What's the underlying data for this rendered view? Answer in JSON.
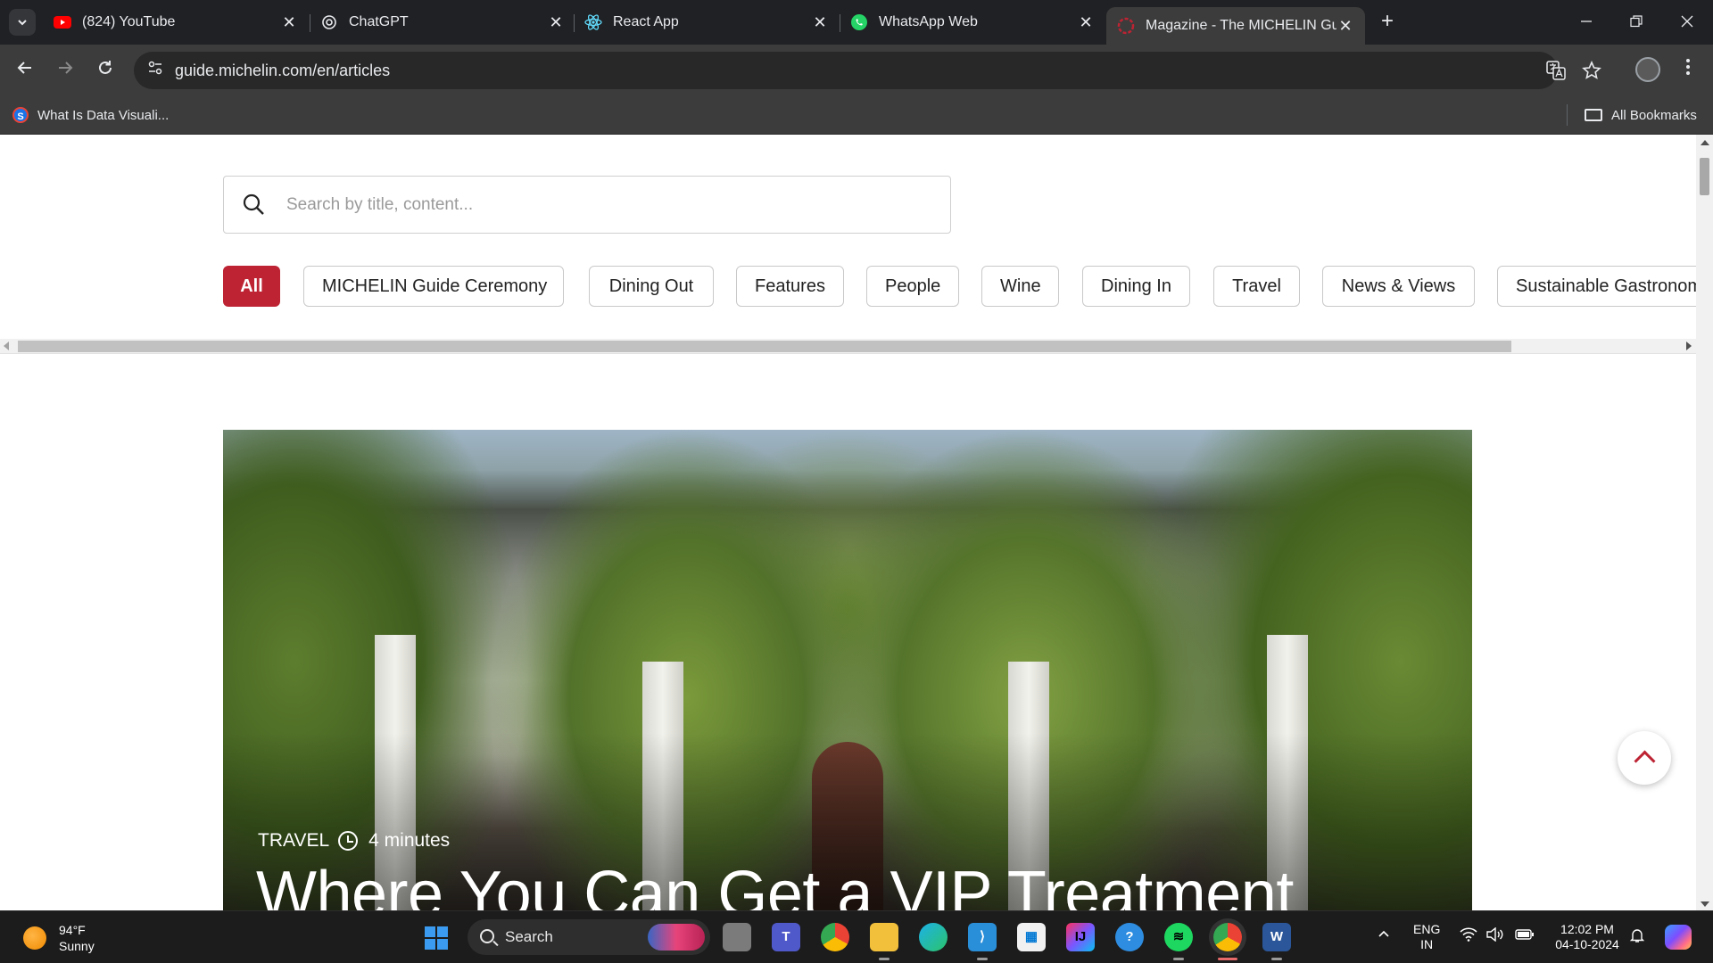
{
  "browser": {
    "tabs": [
      {
        "title": "(824) YouTube",
        "icon": "youtube-icon",
        "active": false
      },
      {
        "title": "ChatGPT",
        "icon": "chatgpt-icon",
        "active": false
      },
      {
        "title": "React App",
        "icon": "react-icon",
        "active": false
      },
      {
        "title": "WhatsApp Web",
        "icon": "whatsapp-icon",
        "active": false
      },
      {
        "title": "Magazine - The MICHELIN Guide",
        "icon": "michelin-icon",
        "active": true
      }
    ],
    "new_tab": "+",
    "url": "guide.michelin.com/en/articles",
    "bookmarks": [
      {
        "label": "What Is Data Visuali..."
      }
    ],
    "all_bookmarks": "All Bookmarks"
  },
  "page": {
    "search": {
      "placeholder": "Search by title, content..."
    },
    "categories": [
      "All",
      "MICHELIN Guide Ceremony",
      "Dining Out",
      "Features",
      "People",
      "Wine",
      "Dining In",
      "Travel",
      "News & Views",
      "Sustainable Gastronomy"
    ],
    "active_category": "All",
    "hero": {
      "category": "TRAVEL",
      "read_time": "4 minutes",
      "title": "Where You Can Get a VIP Treatment"
    }
  },
  "taskbar": {
    "weather": {
      "temp": "94°F",
      "condition": "Sunny"
    },
    "search_label": "Search",
    "language": {
      "line1": "ENG",
      "line2": "IN"
    },
    "time": "12:02 PM",
    "date": "04-10-2024"
  },
  "colors": {
    "accent": "#bd2333",
    "chrome_bg": "#202124",
    "toolbar_bg": "#3c3c3c"
  }
}
